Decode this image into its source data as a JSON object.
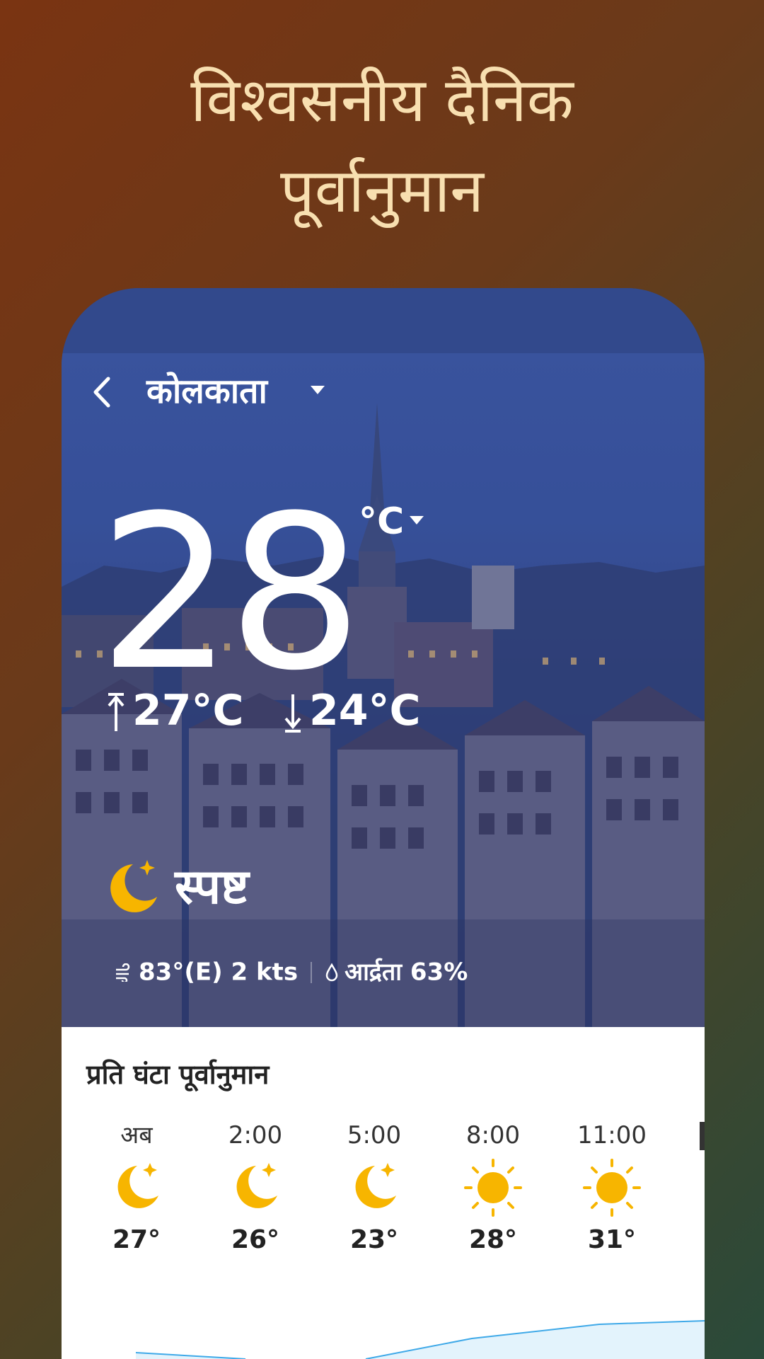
{
  "promo": {
    "line1": "विश्वसनीय दैनिक",
    "line2": "पूर्वानुमान"
  },
  "header": {
    "city": "कोलकाता"
  },
  "current": {
    "temp": "28",
    "unit": "°C",
    "high": "27°C",
    "low": "24°C",
    "condition": "स्पष्ट",
    "wind": "83°(E) 2 kts",
    "humidity": "आर्द्रता 63%"
  },
  "hourly": {
    "title": "प्रति घंटा पूर्वानुमान",
    "items": [
      {
        "time": "अब",
        "icon": "moon-star-icon",
        "temp": "27°"
      },
      {
        "time": "2:00",
        "icon": "moon-star-icon",
        "temp": "26°"
      },
      {
        "time": "5:00",
        "icon": "moon-star-icon",
        "temp": "23°"
      },
      {
        "time": "8:00",
        "icon": "sun-icon",
        "temp": "28°"
      },
      {
        "time": "11:00",
        "icon": "sun-icon",
        "temp": "31°"
      }
    ]
  },
  "colors": {
    "promo_text": "#f8dfb0",
    "hero_bg": "#3a56a2",
    "icon_yellow": "#f7b500",
    "trend_line": "#3fa9e8"
  }
}
